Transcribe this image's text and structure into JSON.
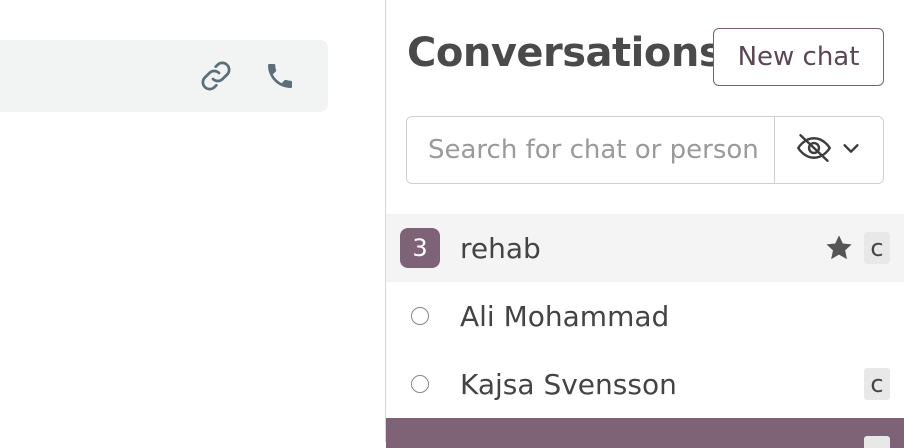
{
  "call_bar": {
    "icons": [
      "link-icon",
      "phone-icon"
    ]
  },
  "conversations": {
    "title": "Conversations",
    "new_chat_label": "New chat",
    "search_placeholder": "Search for chat or person",
    "filter_icons": [
      "eye-off-icon",
      "chevron-down-icon"
    ],
    "items": [
      {
        "name": "rehab",
        "unread": "3",
        "starred": true,
        "tag": "c"
      },
      {
        "name": "Ali Mohammad",
        "unread": "",
        "starred": false,
        "tag": ""
      },
      {
        "name": "Kajsa Svensson",
        "unread": "",
        "starred": false,
        "tag": "c"
      }
    ]
  },
  "colors": {
    "accent": "#7e6377",
    "icon": "#5b6f7a",
    "bar_bg": "#f2f3f3"
  }
}
